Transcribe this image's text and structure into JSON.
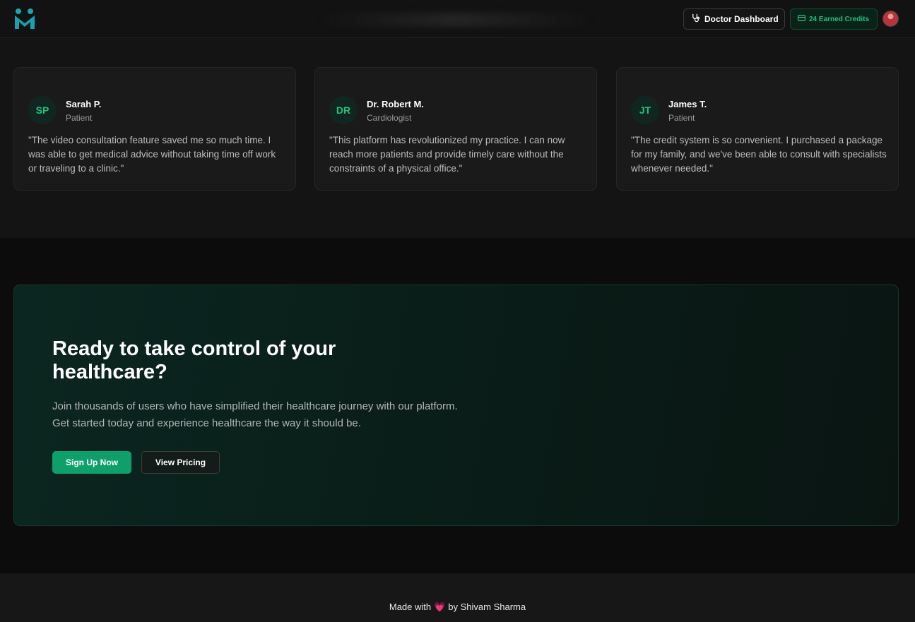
{
  "header": {
    "doctor_dashboard_label": "Doctor Dashboard",
    "credits_label": "24 Earned Credits",
    "accent": "#21c07a"
  },
  "testimonials": [
    {
      "initials": "SP",
      "name": "Sarah P.",
      "role": "Patient",
      "quote": "\"The video consultation feature saved me so much time. I was able to get medical advice without taking time off work or traveling to a clinic.\""
    },
    {
      "initials": "DR",
      "name": "Dr. Robert M.",
      "role": "Cardiologist",
      "quote": "\"This platform has revolutionized my practice. I can now reach more patients and provide timely care without the constraints of a physical office.\""
    },
    {
      "initials": "JT",
      "name": "James T.",
      "role": "Patient",
      "quote": "\"The credit system is so convenient. I purchased a package for my family, and we've been able to consult with specialists whenever needed.\""
    }
  ],
  "cta": {
    "title": "Ready to take control of your healthcare?",
    "description": "Join thousands of users who have simplified their healthcare journey with our platform. Get started today and experience healthcare the way it should be.",
    "primary_button": "Sign Up Now",
    "secondary_button": "View Pricing"
  },
  "footer": {
    "made_with": "Made with",
    "by": "by Shivam Sharma"
  },
  "icons": {
    "logo": "medical-m-logo-icon",
    "doctor": "stethoscope-icon",
    "credits": "credit-card-icon",
    "heart": "heart-icon"
  }
}
